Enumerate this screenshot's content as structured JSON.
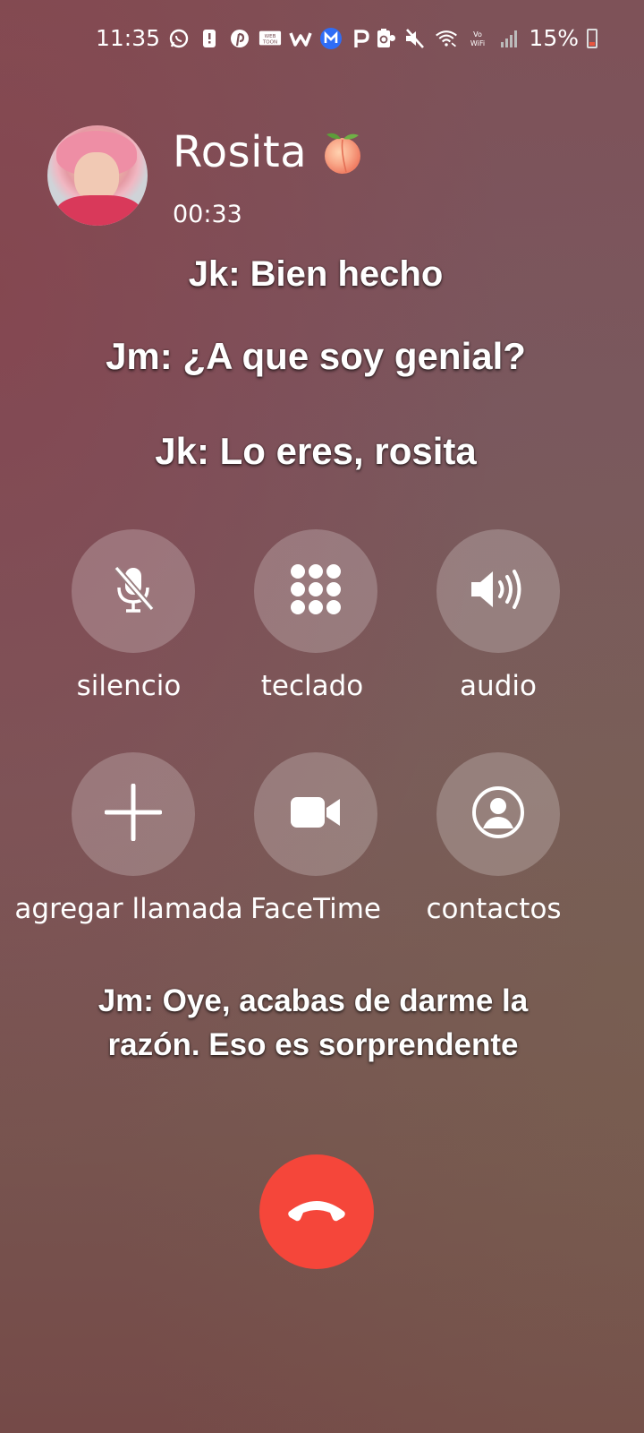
{
  "status_bar": {
    "time": "11:35",
    "battery": "15%",
    "left_icons": [
      "whatsapp-icon",
      "notification-alert-icon",
      "pinterest-icon",
      "webtoon-icon",
      "wattpad-icon",
      "app-m-icon",
      "patreon-icon"
    ],
    "right_icons": [
      "battery-saver-icon",
      "mute-icon",
      "wifi-call-icon",
      "vowifi-icon",
      "signal-icon",
      "battery-icon"
    ]
  },
  "call": {
    "contact_name": "Rosita",
    "contact_emoji": "peach-emoji",
    "timer": "00:33"
  },
  "captions": {
    "line1": "Jk: Bien hecho",
    "line2": "Jm: ¿A que soy genial?",
    "line3": "Jk: Lo eres, rosita",
    "line4": "Jm: Oye, acabas de darme la razón. Eso es sorprendente"
  },
  "controls": {
    "mute": "silencio",
    "keypad": "teclado",
    "audio": "audio",
    "add_call": "agregar llamada",
    "facetime": "FaceTime",
    "contacts": "contactos"
  },
  "colors": {
    "end_call": "#f5463a",
    "button_bg": "rgba(255,255,255,0.22)"
  }
}
